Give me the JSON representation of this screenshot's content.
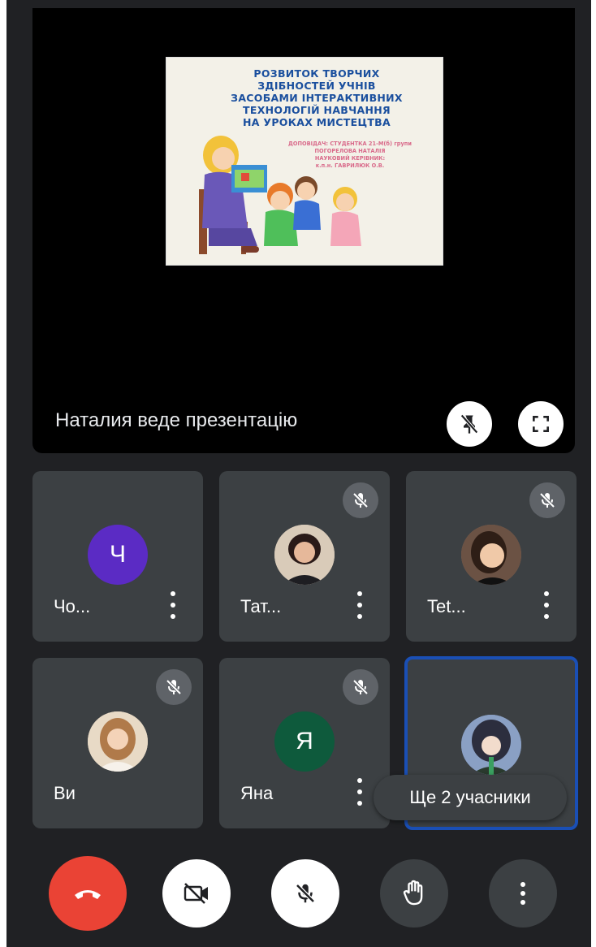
{
  "slide": {
    "title_lines": [
      "РОЗВИТОК ТВОРЧИХ",
      "ЗДІБНОСТЕЙ УЧНІВ",
      "ЗАСОБАМИ ІНТЕРАКТИВНИХ",
      "ТЕХНОЛОГІЙ НАВЧАННЯ",
      "НА УРОКАХ МИСТЕЦТВА"
    ],
    "credit_lines": [
      "ДОПОВІДАЧ: СТУДЕНТКА 21-М(б) групи",
      "ПОГОРЕЛОВА НАТАЛІЯ",
      "НАУКОВИЙ КЕРІВНИК:",
      "к.п.н. ГАВРИЛЮК О.В."
    ]
  },
  "stage": {
    "presenter_text": "Наталия веде презентацію",
    "pin_icon": "pin-off-icon",
    "fullscreen_icon": "fullscreen-icon"
  },
  "participants": [
    {
      "name": "Чо...",
      "initial": "Ч",
      "avatar_color": "#5b2bc4",
      "muted": false
    },
    {
      "name": "Тат...",
      "initial": "",
      "avatar_color": "#c9b8a6",
      "muted": true
    },
    {
      "name": "Tet...",
      "initial": "",
      "avatar_color": "#8a6a58",
      "muted": true
    },
    {
      "name": "Ви",
      "initial": "",
      "avatar_color": "#d8c3a8",
      "muted": true
    },
    {
      "name": "Яна",
      "initial": "Я",
      "avatar_color": "#0e5a3c",
      "muted": true
    },
    {
      "name": "",
      "initial": "",
      "avatar_color": "#6b7fa3",
      "muted": false
    }
  ],
  "more_participants_label": "Ще 2 учасники",
  "controls": {
    "end_call": "end-call-icon",
    "camera": "camera-off-icon",
    "mic": "mic-off-icon",
    "raise_hand": "hand-icon",
    "more": "more-vert-icon"
  },
  "colors": {
    "background": "#202124",
    "tile": "#3c4043",
    "end_call": "#ea4335",
    "selected_border": "#1a4fb5"
  }
}
